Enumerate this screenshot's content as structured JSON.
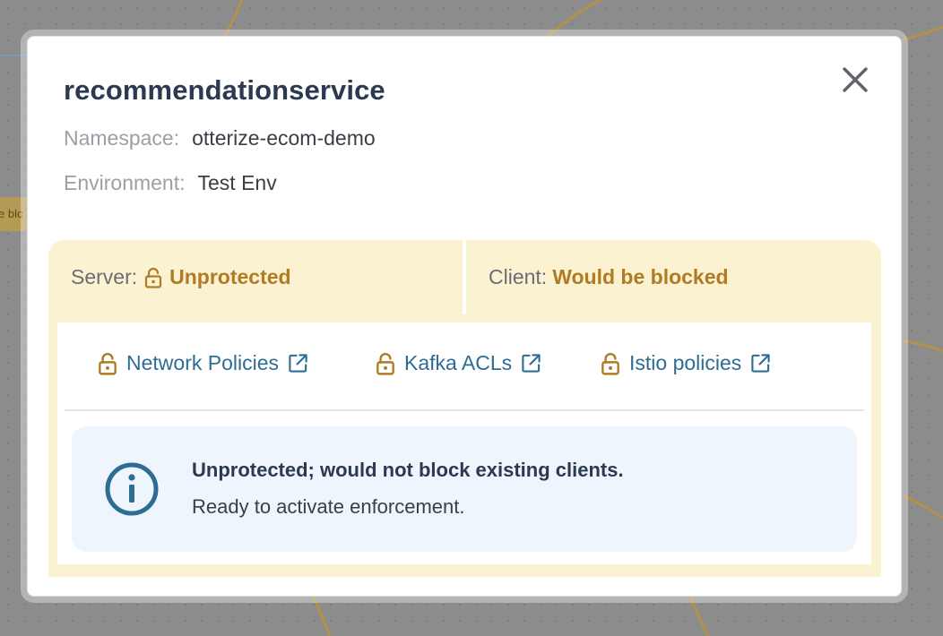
{
  "background": {
    "node_label_fragment": "e blc"
  },
  "modal": {
    "title": "recommendationservice",
    "close_icon": "close-icon",
    "namespace": {
      "label": "Namespace:",
      "value": "otterize-ecom-demo"
    },
    "environment": {
      "label": "Environment:",
      "value": "Test Env"
    },
    "status": {
      "server": {
        "label": "Server:",
        "value": "Unprotected",
        "icon": "unlock-icon"
      },
      "client": {
        "label": "Client:",
        "value": "Would be blocked"
      }
    },
    "policy_links": [
      {
        "label": "Network Policies",
        "icon": "unlock-icon",
        "trailing_icon": "external-link-icon"
      },
      {
        "label": "Kafka ACLs",
        "icon": "unlock-icon",
        "trailing_icon": "external-link-icon"
      },
      {
        "label": "Istio policies",
        "icon": "unlock-icon",
        "trailing_icon": "external-link-icon"
      }
    ],
    "info": {
      "icon": "info-icon",
      "title": "Unprotected; would not block existing clients.",
      "body": "Ready to activate enforcement."
    }
  },
  "colors": {
    "warning_text": "#b07b24",
    "warning_bg": "#fbf2d1",
    "link": "#2d6d94",
    "info_bg": "#eef5fc",
    "title": "#2b3a50"
  }
}
